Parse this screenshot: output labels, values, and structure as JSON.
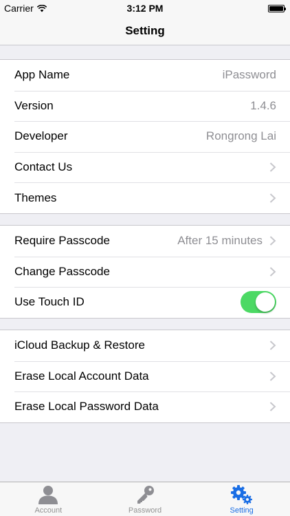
{
  "status": {
    "carrier": "Carrier",
    "time": "3:12 PM"
  },
  "nav": {
    "title": "Setting"
  },
  "groups": [
    {
      "rows": [
        {
          "label": "App Name",
          "value": "iPassword"
        },
        {
          "label": "Version",
          "value": "1.4.6"
        },
        {
          "label": "Developer",
          "value": "Rongrong Lai"
        },
        {
          "label": "Contact Us"
        },
        {
          "label": "Themes"
        }
      ]
    },
    {
      "rows": [
        {
          "label": "Require Passcode",
          "value": "After 15 minutes"
        },
        {
          "label": "Change Passcode"
        },
        {
          "label": "Use Touch ID",
          "toggle_on": true
        }
      ]
    },
    {
      "rows": [
        {
          "label": "iCloud Backup & Restore"
        },
        {
          "label": "Erase Local Account Data"
        },
        {
          "label": "Erase Local Password Data"
        }
      ]
    }
  ],
  "tabs": [
    {
      "label": "Account",
      "icon": "person-icon"
    },
    {
      "label": "Password",
      "icon": "key-icon"
    },
    {
      "label": "Setting",
      "icon": "gears-icon",
      "active": true
    }
  ],
  "colors": {
    "accent": "#1a6ee5",
    "switch_on": "#4cd964",
    "background": "#efeff4"
  }
}
